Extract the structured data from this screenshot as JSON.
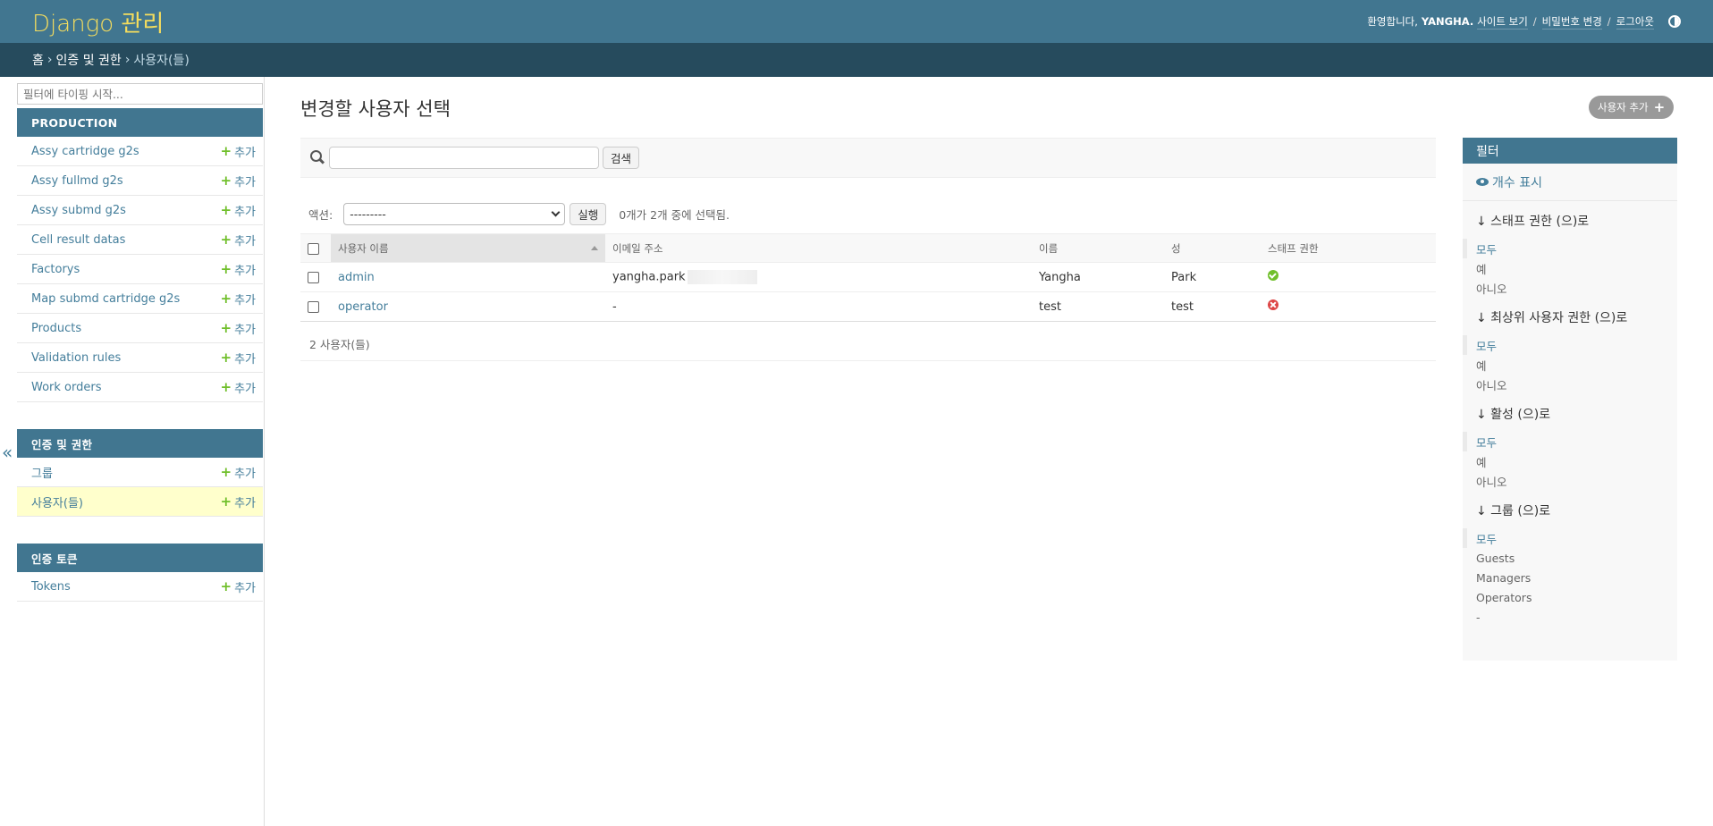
{
  "header": {
    "brand": "Django 관리",
    "welcome": "환영합니다,",
    "username": "YANGHA.",
    "view_site": "사이트 보기",
    "change_password": "비밀번호 변경",
    "logout": "로그아웃",
    "separator": "/"
  },
  "breadcrumbs": {
    "home": "홈",
    "app": "인증 및 권한",
    "current": "사용자(들)",
    "sep": "›"
  },
  "sidebar": {
    "filter_placeholder": "필터에 타이핑 시작...",
    "add_label": "추가",
    "collapse": "«",
    "modules": [
      {
        "caption": "PRODUCTION",
        "models": [
          "Assy cartridge g2s",
          "Assy fullmd g2s",
          "Assy submd g2s",
          "Cell result datas",
          "Factorys",
          "Map submd cartridge g2s",
          "Products",
          "Validation rules",
          "Work orders"
        ]
      },
      {
        "caption": "인증 및 권한",
        "models": [
          "그룹",
          "사용자(들)"
        ]
      },
      {
        "caption": "인증 토큰",
        "models": [
          "Tokens"
        ]
      }
    ]
  },
  "main": {
    "title": "변경할 사용자 선택",
    "add_user_button": "사용자 추가",
    "search_button": "검색",
    "actions_label": "액션:",
    "action_selected": "---------",
    "go_button": "실행",
    "action_counter": "0개가 2개 중에 선택됨.",
    "columns": [
      "사용자 이름",
      "이메일 주소",
      "이름",
      "성",
      "스태프 권한"
    ],
    "rows": [
      {
        "username": "admin",
        "email": "yangha.park",
        "first": "Yangha",
        "last": "Park",
        "staff": true
      },
      {
        "username": "operator",
        "email": "-",
        "first": "test",
        "last": "test",
        "staff": false
      }
    ],
    "paginator": "2 사용자(들)"
  },
  "filter": {
    "title": "필터",
    "show_counts": "개수 표시",
    "groups": [
      {
        "title": "↓ 스태프 권한 (으)로",
        "options": [
          "모두",
          "예",
          "아니오"
        ]
      },
      {
        "title": "↓ 최상위 사용자 권한 (으)로",
        "options": [
          "모두",
          "예",
          "아니오"
        ]
      },
      {
        "title": "↓ 활성 (으)로",
        "options": [
          "모두",
          "예",
          "아니오"
        ]
      },
      {
        "title": "↓ 그룹 (으)로",
        "options": [
          "모두",
          "Guests",
          "Managers",
          "Operators",
          "-"
        ]
      }
    ]
  }
}
